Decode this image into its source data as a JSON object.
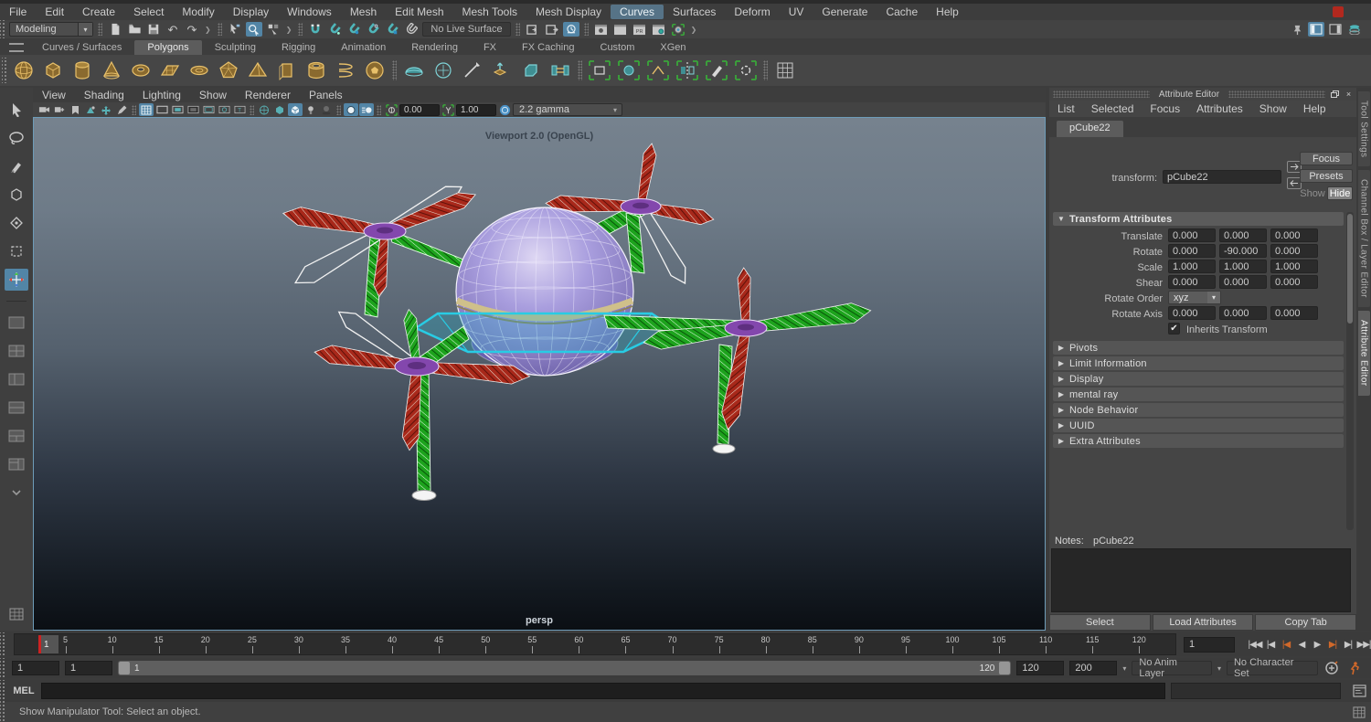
{
  "menu_bar": {
    "items": [
      "File",
      "Edit",
      "Create",
      "Select",
      "Modify",
      "Display",
      "Windows",
      "Mesh",
      "Edit Mesh",
      "Mesh Tools",
      "Mesh Display",
      "Curves",
      "Surfaces",
      "Deform",
      "UV",
      "Generate",
      "Cache",
      "Help"
    ]
  },
  "status_line": {
    "mode_selector": "Modeling",
    "live_surface_label": "No Live Surface"
  },
  "shelf": {
    "tabs": [
      "Curves / Surfaces",
      "Polygons",
      "Sculpting",
      "Rigging",
      "Animation",
      "Rendering",
      "FX",
      "FX Caching",
      "Custom",
      "XGen"
    ],
    "active_tab": "Polygons"
  },
  "viewport": {
    "menu": [
      "View",
      "Shading",
      "Lighting",
      "Show",
      "Renderer",
      "Panels"
    ],
    "exposure_value": "0.00",
    "gamma_value": "1.00",
    "gamma_preset": "2.2 gamma",
    "renderer_label": "Viewport 2.0 (OpenGL)",
    "camera_label": "persp"
  },
  "attribute_editor": {
    "title": "Attribute Editor",
    "menu": [
      "List",
      "Selected",
      "Focus",
      "Attributes",
      "Show",
      "Help"
    ],
    "tab": "pCube22",
    "transform_label": "transform:",
    "transform_value": "pCube22",
    "focus_button": "Focus",
    "presets_button": "Presets",
    "show_button": "Show",
    "hide_button": "Hide",
    "transform_attributes": {
      "title": "Transform Attributes",
      "rows": [
        {
          "label": "Translate",
          "values": [
            "0.000",
            "0.000",
            "0.000"
          ]
        },
        {
          "label": "Rotate",
          "values": [
            "0.000",
            "-90.000",
            "0.000"
          ]
        },
        {
          "label": "Scale",
          "values": [
            "1.000",
            "1.000",
            "1.000"
          ]
        },
        {
          "label": "Shear",
          "values": [
            "0.000",
            "0.000",
            "0.000"
          ]
        }
      ],
      "rotate_order_label": "Rotate Order",
      "rotate_order_value": "xyz",
      "rotate_axis_label": "Rotate Axis",
      "rotate_axis_values": [
        "0.000",
        "0.000",
        "0.000"
      ],
      "inherits_transform_label": "Inherits Transform",
      "inherits_transform_checked": true
    },
    "collapsed_sections": [
      "Pivots",
      "Limit Information",
      "Display",
      "mental ray",
      "Node Behavior",
      "UUID",
      "Extra Attributes"
    ],
    "notes_label": "Notes:",
    "notes_value": "pCube22",
    "footer_buttons": [
      "Select",
      "Load Attributes",
      "Copy Tab"
    ]
  },
  "right_dock": {
    "tabs": [
      "Tool Settings",
      "Channel Box / Layer Editor",
      "Attribute Editor"
    ],
    "active_tab": "Attribute Editor"
  },
  "timeline": {
    "tick_labels": [
      "5",
      "10",
      "15",
      "20",
      "25",
      "30",
      "35",
      "40",
      "45",
      "50",
      "55",
      "60",
      "65",
      "70",
      "75",
      "80",
      "85",
      "90",
      "95",
      "100",
      "105",
      "110",
      "115",
      "120"
    ],
    "current_frame": "1",
    "current_frame_field": "1"
  },
  "range_slider": {
    "animation_start": "1",
    "playback_start": "1",
    "range_bar_start": "1",
    "range_bar_end": "120",
    "playback_end": "120",
    "animation_end": "200",
    "anim_layer": "No Anim Layer",
    "character_set": "No Character Set"
  },
  "command_line": {
    "label": "MEL",
    "input_value": ""
  },
  "help_line": {
    "text": "Show Manipulator Tool: Select an object."
  },
  "icons": {
    "undo": "↶",
    "redo": "↷",
    "close": "×",
    "dropdown_arrow": "▾",
    "section_expanded": "▼",
    "section_collapsed": "▶",
    "checkmark": "✔",
    "playback": [
      "|◀◀",
      "|◀",
      "|◀",
      "◀",
      "▶",
      "▶|",
      "▶|",
      "▶▶|"
    ]
  },
  "colors": {
    "highlight": "#5285a6",
    "key_orange": "#d0682a",
    "snap_teal": "#4fb6ba",
    "shelf_gold": "#cfa14f",
    "viewport_top": "#76828e",
    "viewport_bottom": "#0b0f14"
  }
}
